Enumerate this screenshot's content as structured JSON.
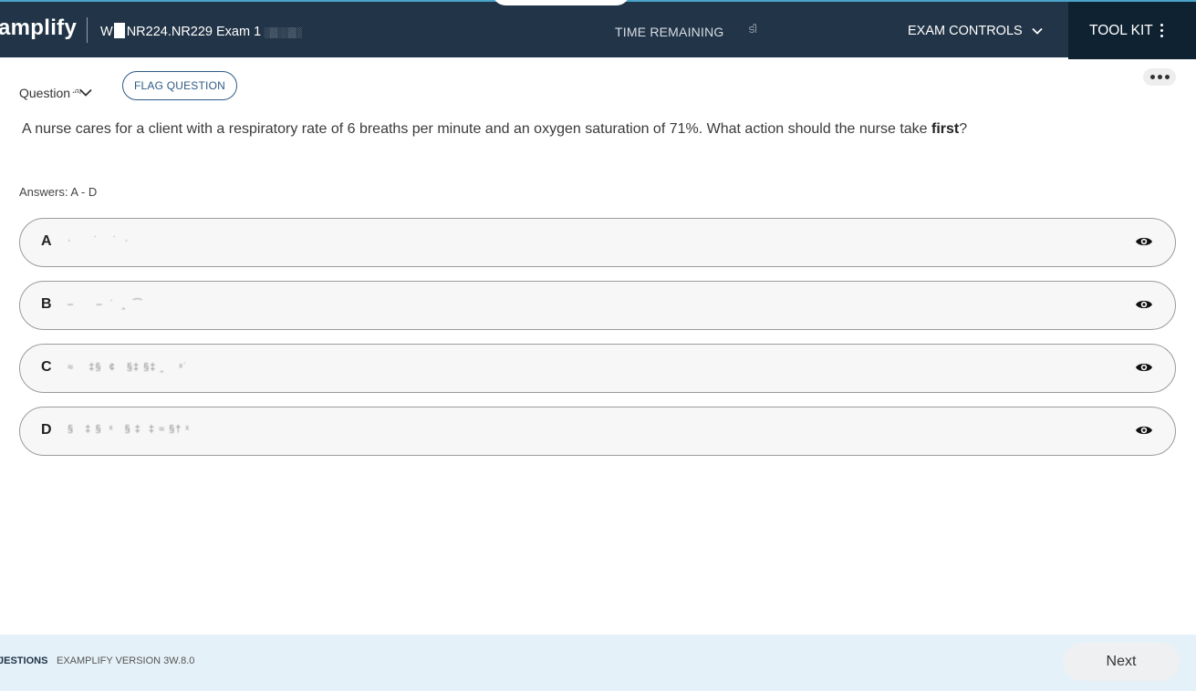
{
  "header": {
    "logo_text": "amplify",
    "exam_title_prefix": "W",
    "exam_title": "NR224.NR229 Exam 1",
    "exam_title_suffix": "░▒░░▒░",
    "time_remaining_label": "TIME REMAINING",
    "time_remaining_value": "ടി",
    "exam_controls_label": "EXAM CONTROLS",
    "toolkit_label": "TOOL KIT",
    "colors": {
      "header_bg": "#223447",
      "toolkit_bg": "#0f2232",
      "accent": "#4aa3c9"
    }
  },
  "question": {
    "label": "Question",
    "number_scribble": ".ླ.",
    "flag_label": "FLAG QUESTION",
    "more_icon": "ellipsis-icon",
    "stem_before": "A nurse cares for a client with a respiratory rate of 6 breaths per minute and an oxygen saturation of 71%. What action should the nurse take ",
    "stem_emphasis": "first",
    "stem_after": "?",
    "answers_label": "Answers: A - D"
  },
  "options": [
    {
      "letter": "A",
      "text": "·      ˙    ˙  ·"
    },
    {
      "letter": "B",
      "text": "–      –  ˙  ‸  ⁀"
    },
    {
      "letter": "C",
      "text": "≈    ‡§  ¢   §‡ §‡ ‸    ˣ˙"
    },
    {
      "letter": "D",
      "text": "§   ‡ §  ˣ   § ‡  ‡ ≈ §† ˣ"
    }
  ],
  "footer": {
    "questions_link": "JESTIONS",
    "version_text": "EXAMPLIFY VERSION 3W.8.0",
    "next_label": "Next",
    "bg_color": "#e5f1f9"
  }
}
